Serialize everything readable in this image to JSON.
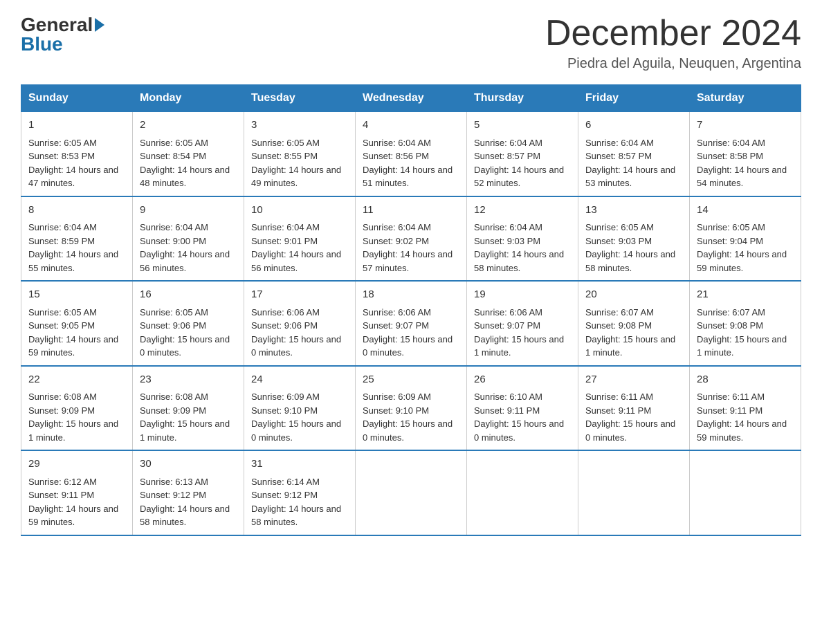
{
  "header": {
    "logo_general": "General",
    "logo_blue": "Blue",
    "month_title": "December 2024",
    "location": "Piedra del Aguila, Neuquen, Argentina"
  },
  "days_of_week": [
    "Sunday",
    "Monday",
    "Tuesday",
    "Wednesday",
    "Thursday",
    "Friday",
    "Saturday"
  ],
  "weeks": [
    [
      {
        "day": "1",
        "sunrise": "6:05 AM",
        "sunset": "8:53 PM",
        "daylight": "14 hours and 47 minutes."
      },
      {
        "day": "2",
        "sunrise": "6:05 AM",
        "sunset": "8:54 PM",
        "daylight": "14 hours and 48 minutes."
      },
      {
        "day": "3",
        "sunrise": "6:05 AM",
        "sunset": "8:55 PM",
        "daylight": "14 hours and 49 minutes."
      },
      {
        "day": "4",
        "sunrise": "6:04 AM",
        "sunset": "8:56 PM",
        "daylight": "14 hours and 51 minutes."
      },
      {
        "day": "5",
        "sunrise": "6:04 AM",
        "sunset": "8:57 PM",
        "daylight": "14 hours and 52 minutes."
      },
      {
        "day": "6",
        "sunrise": "6:04 AM",
        "sunset": "8:57 PM",
        "daylight": "14 hours and 53 minutes."
      },
      {
        "day": "7",
        "sunrise": "6:04 AM",
        "sunset": "8:58 PM",
        "daylight": "14 hours and 54 minutes."
      }
    ],
    [
      {
        "day": "8",
        "sunrise": "6:04 AM",
        "sunset": "8:59 PM",
        "daylight": "14 hours and 55 minutes."
      },
      {
        "day": "9",
        "sunrise": "6:04 AM",
        "sunset": "9:00 PM",
        "daylight": "14 hours and 56 minutes."
      },
      {
        "day": "10",
        "sunrise": "6:04 AM",
        "sunset": "9:01 PM",
        "daylight": "14 hours and 56 minutes."
      },
      {
        "day": "11",
        "sunrise": "6:04 AM",
        "sunset": "9:02 PM",
        "daylight": "14 hours and 57 minutes."
      },
      {
        "day": "12",
        "sunrise": "6:04 AM",
        "sunset": "9:03 PM",
        "daylight": "14 hours and 58 minutes."
      },
      {
        "day": "13",
        "sunrise": "6:05 AM",
        "sunset": "9:03 PM",
        "daylight": "14 hours and 58 minutes."
      },
      {
        "day": "14",
        "sunrise": "6:05 AM",
        "sunset": "9:04 PM",
        "daylight": "14 hours and 59 minutes."
      }
    ],
    [
      {
        "day": "15",
        "sunrise": "6:05 AM",
        "sunset": "9:05 PM",
        "daylight": "14 hours and 59 minutes."
      },
      {
        "day": "16",
        "sunrise": "6:05 AM",
        "sunset": "9:06 PM",
        "daylight": "15 hours and 0 minutes."
      },
      {
        "day": "17",
        "sunrise": "6:06 AM",
        "sunset": "9:06 PM",
        "daylight": "15 hours and 0 minutes."
      },
      {
        "day": "18",
        "sunrise": "6:06 AM",
        "sunset": "9:07 PM",
        "daylight": "15 hours and 0 minutes."
      },
      {
        "day": "19",
        "sunrise": "6:06 AM",
        "sunset": "9:07 PM",
        "daylight": "15 hours and 1 minute."
      },
      {
        "day": "20",
        "sunrise": "6:07 AM",
        "sunset": "9:08 PM",
        "daylight": "15 hours and 1 minute."
      },
      {
        "day": "21",
        "sunrise": "6:07 AM",
        "sunset": "9:08 PM",
        "daylight": "15 hours and 1 minute."
      }
    ],
    [
      {
        "day": "22",
        "sunrise": "6:08 AM",
        "sunset": "9:09 PM",
        "daylight": "15 hours and 1 minute."
      },
      {
        "day": "23",
        "sunrise": "6:08 AM",
        "sunset": "9:09 PM",
        "daylight": "15 hours and 1 minute."
      },
      {
        "day": "24",
        "sunrise": "6:09 AM",
        "sunset": "9:10 PM",
        "daylight": "15 hours and 0 minutes."
      },
      {
        "day": "25",
        "sunrise": "6:09 AM",
        "sunset": "9:10 PM",
        "daylight": "15 hours and 0 minutes."
      },
      {
        "day": "26",
        "sunrise": "6:10 AM",
        "sunset": "9:11 PM",
        "daylight": "15 hours and 0 minutes."
      },
      {
        "day": "27",
        "sunrise": "6:11 AM",
        "sunset": "9:11 PM",
        "daylight": "15 hours and 0 minutes."
      },
      {
        "day": "28",
        "sunrise": "6:11 AM",
        "sunset": "9:11 PM",
        "daylight": "14 hours and 59 minutes."
      }
    ],
    [
      {
        "day": "29",
        "sunrise": "6:12 AM",
        "sunset": "9:11 PM",
        "daylight": "14 hours and 59 minutes."
      },
      {
        "day": "30",
        "sunrise": "6:13 AM",
        "sunset": "9:12 PM",
        "daylight": "14 hours and 58 minutes."
      },
      {
        "day": "31",
        "sunrise": "6:14 AM",
        "sunset": "9:12 PM",
        "daylight": "14 hours and 58 minutes."
      },
      null,
      null,
      null,
      null
    ]
  ]
}
